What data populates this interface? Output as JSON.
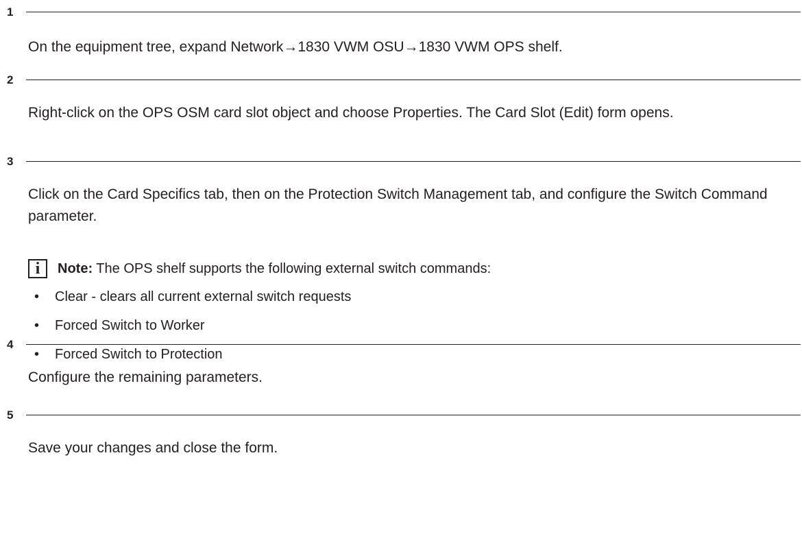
{
  "steps": [
    {
      "number": "1",
      "text": "On the equipment tree, expand Network→1830 VWM OSU→1830 VWM OPS shelf."
    },
    {
      "number": "2",
      "text": "Right-click on the OPS OSM card slot object and choose Properties. The Card Slot (Edit) form opens."
    },
    {
      "number": "3",
      "text": "Click on the Card Specifics tab, then on the Protection Switch Management tab, and configure the Switch Command parameter.",
      "note": {
        "icon": "info-icon",
        "icon_glyph": "i",
        "label": "Note:",
        "text": " The OPS shelf supports the following external switch commands:",
        "bullet_glyph": "•",
        "bullets": [
          "Clear - clears all current external switch requests",
          "Forced Switch to Worker",
          "Forced Switch to Protection"
        ]
      }
    },
    {
      "number": "4",
      "text": "Configure the remaining parameters."
    },
    {
      "number": "5",
      "text": "Save your changes and close the form."
    }
  ]
}
